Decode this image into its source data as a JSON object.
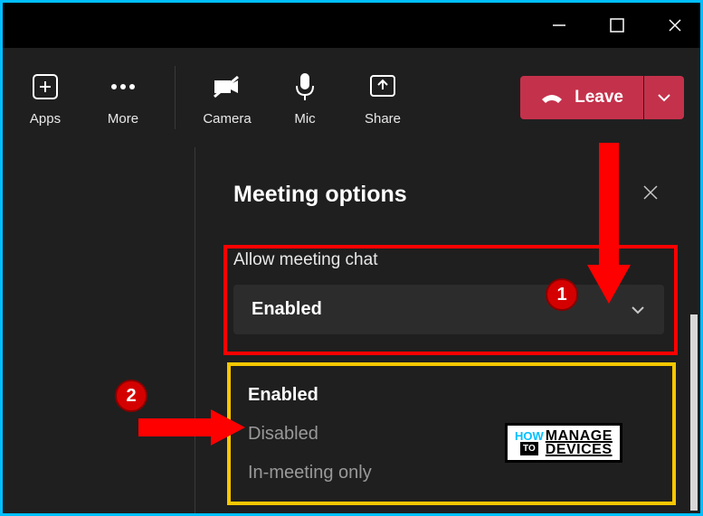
{
  "titlebar": {
    "minimize": "—",
    "maximize": "▢",
    "close": "✕"
  },
  "toolbar": {
    "apps": "Apps",
    "more": "More",
    "camera": "Camera",
    "mic": "Mic",
    "share": "Share",
    "leave": "Leave"
  },
  "panel": {
    "title": "Meeting options",
    "setting_label": "Allow meeting chat",
    "selected_value": "Enabled",
    "options": [
      "Enabled",
      "Disabled",
      "In-meeting only"
    ]
  },
  "annotations": {
    "marker1": "1",
    "marker2": "2"
  },
  "watermark": {
    "how": "HOW",
    "to": "TO",
    "main": "MANAGE",
    "sub": "DEVICES"
  }
}
